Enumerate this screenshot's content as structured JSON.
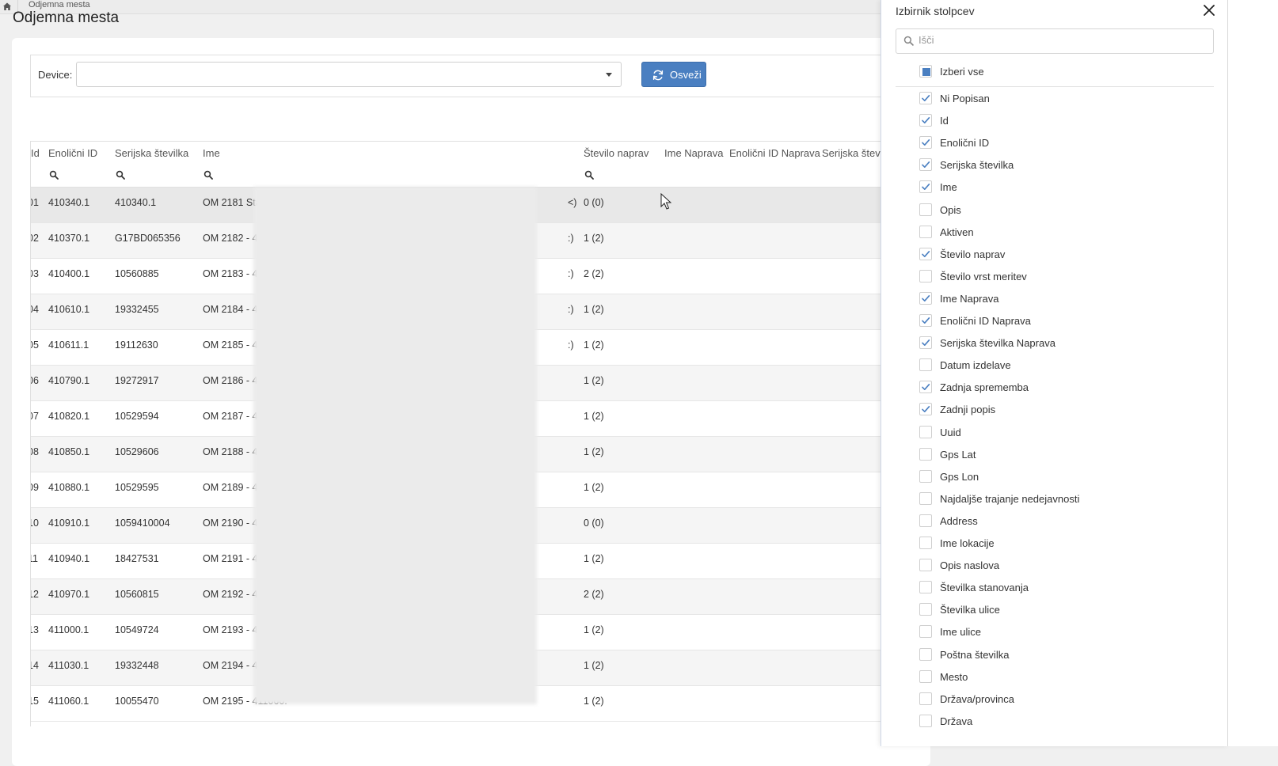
{
  "topbar": {
    "tab_label": "Odjemna mesta"
  },
  "page": {
    "title": "Odjemna mesta"
  },
  "toolbar": {
    "device_label": "Device:",
    "device_value": "",
    "refresh_label": "Osveži"
  },
  "table": {
    "headers": {
      "id": "Id",
      "unique_id": "Enolični ID",
      "serial": "Serijska številka",
      "name": "Ime",
      "device_count": "Število naprav",
      "device_name": "Ime Naprava",
      "device_unique_id": "Enolični ID Naprava",
      "device_serial": "Serijska števil"
    },
    "rows": [
      {
        "id": "01",
        "unique_id": "410340.1",
        "serial": "410340.1",
        "name": "OM 2181 Stari - 41(",
        "suffix": "<)",
        "count": "0 (0)"
      },
      {
        "id": "02",
        "unique_id": "410370.1",
        "serial": "G17BD065356",
        "name": "OM 2182 - 410370.",
        "suffix": ":)",
        "count": "1 (2)"
      },
      {
        "id": "03",
        "unique_id": "410400.1",
        "serial": "10560885",
        "name": "OM 2183 - 410400.",
        "suffix": ":)",
        "count": "2 (2)"
      },
      {
        "id": "04",
        "unique_id": "410610.1",
        "serial": "19332455",
        "name": "OM 2184 - 410610.",
        "suffix": ":)",
        "count": "1 (2)"
      },
      {
        "id": "05",
        "unique_id": "410611.1",
        "serial": "19112630",
        "name": "OM 2185 - 410611.",
        "suffix": ":)",
        "count": "1 (2)"
      },
      {
        "id": "06",
        "unique_id": "410790.1",
        "serial": "19272917",
        "name": "OM 2186 - 410790.",
        "suffix": "",
        "count": "1 (2)"
      },
      {
        "id": "07",
        "unique_id": "410820.1",
        "serial": "10529594",
        "name": "OM 2187 - 410820.",
        "suffix": "",
        "count": "1 (2)"
      },
      {
        "id": "08",
        "unique_id": "410850.1",
        "serial": "10529606",
        "name": "OM 2188 - 410850.",
        "suffix": "",
        "count": "1 (2)"
      },
      {
        "id": "09",
        "unique_id": "410880.1",
        "serial": "10529595",
        "name": "OM 2189 - 410880.",
        "suffix": "",
        "count": "1 (2)"
      },
      {
        "id": "10",
        "unique_id": "410910.1",
        "serial": "1059410004",
        "name": "OM 2190 - 410910.",
        "suffix": "",
        "count": "0 (0)"
      },
      {
        "id": "11",
        "unique_id": "410940.1",
        "serial": "18427531",
        "name": "OM 2191 - 410940.",
        "suffix": "",
        "count": "1 (2)"
      },
      {
        "id": "12",
        "unique_id": "410970.1",
        "serial": "10560815",
        "name": "OM 2192 - 410970.",
        "suffix": "",
        "count": "2 (2)"
      },
      {
        "id": "13",
        "unique_id": "411000.1",
        "serial": "10549724",
        "name": "OM 2193 - 411000.",
        "suffix": "",
        "count": "1 (2)"
      },
      {
        "id": "14",
        "unique_id": "411030.1",
        "serial": "19332448",
        "name": "OM 2194 - 411030.",
        "suffix": "",
        "count": "1 (2)"
      },
      {
        "id": "15",
        "unique_id": "411060.1",
        "serial": "10055470",
        "name": "OM 2195 - 411060.",
        "suffix": "",
        "count": "1 (2)"
      }
    ]
  },
  "column_picker": {
    "title": "Izbirnik stolpcev",
    "search_placeholder": "Išči",
    "select_all_label": "Izberi vse",
    "select_all_state": "indeterminate",
    "accent_color": "#4a7fc1",
    "columns": [
      {
        "label": "Ni Popisan",
        "checked": true
      },
      {
        "label": "Id",
        "checked": true
      },
      {
        "label": "Enolični ID",
        "checked": true
      },
      {
        "label": "Serijska številka",
        "checked": true
      },
      {
        "label": "Ime",
        "checked": true
      },
      {
        "label": "Opis",
        "checked": false
      },
      {
        "label": "Aktiven",
        "checked": false
      },
      {
        "label": "Število naprav",
        "checked": true
      },
      {
        "label": "Število vrst meritev",
        "checked": false
      },
      {
        "label": "Ime Naprava",
        "checked": true
      },
      {
        "label": "Enolični ID Naprava",
        "checked": true
      },
      {
        "label": "Serijska številka Naprava",
        "checked": true
      },
      {
        "label": "Datum izdelave",
        "checked": false
      },
      {
        "label": "Zadnja sprememba",
        "checked": true
      },
      {
        "label": "Zadnji popis",
        "checked": true
      },
      {
        "label": "Uuid",
        "checked": false
      },
      {
        "label": "Gps Lat",
        "checked": false
      },
      {
        "label": "Gps Lon",
        "checked": false
      },
      {
        "label": "Najdaljše trajanje nedejavnosti",
        "checked": false
      },
      {
        "label": "Address",
        "checked": false
      },
      {
        "label": "Ime lokacije",
        "checked": false
      },
      {
        "label": "Opis naslova",
        "checked": false
      },
      {
        "label": "Številka stanovanja",
        "checked": false
      },
      {
        "label": "Številka ulice",
        "checked": false
      },
      {
        "label": "Ime ulice",
        "checked": false
      },
      {
        "label": "Poštna številka",
        "checked": false
      },
      {
        "label": "Mesto",
        "checked": false
      },
      {
        "label": "Država/provinca",
        "checked": false
      },
      {
        "label": "Država",
        "checked": false
      }
    ]
  }
}
